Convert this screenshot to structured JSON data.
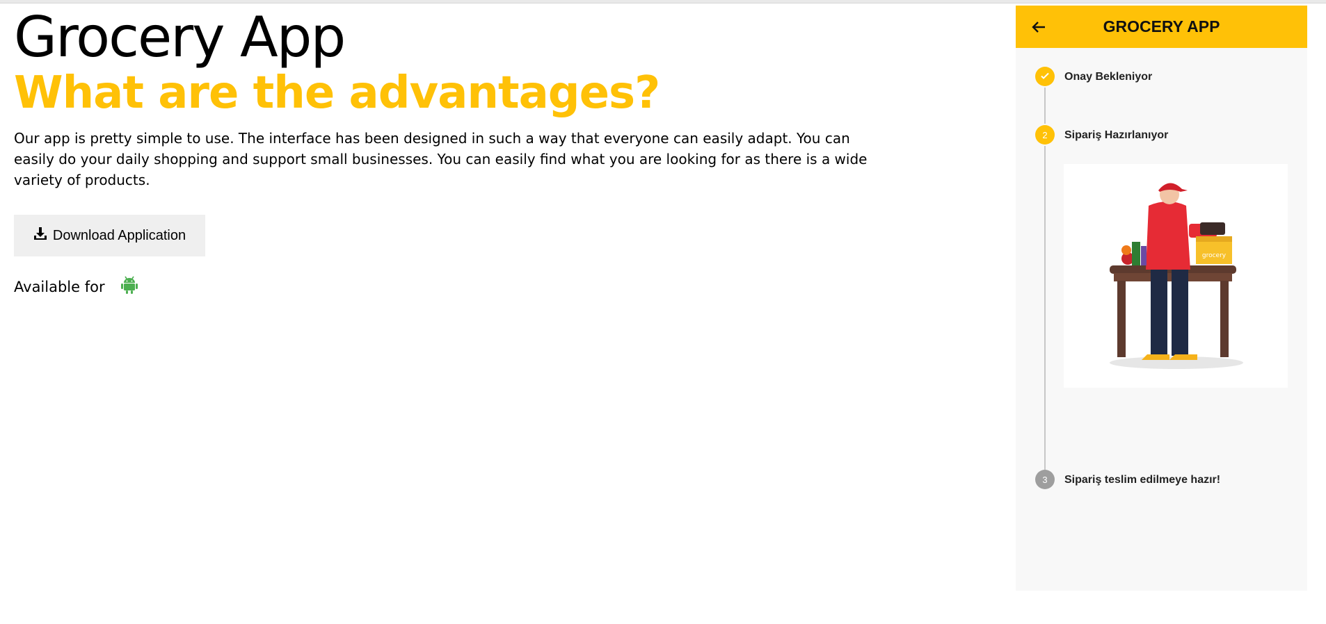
{
  "hero": {
    "title": "Grocery App",
    "subtitle": "What are the advantages?",
    "description": "Our app is pretty simple to use. The interface has been designed in such a way that everyone can easily adapt. You can easily do your daily shopping and support small businesses. You can easily find what you are looking for as there is a wide variety of products.",
    "download_label": "Download Application",
    "available_label": "Available for"
  },
  "phone": {
    "title": "GROCERY APP",
    "steps": [
      {
        "number": "1",
        "label": "Onay Bekleniyor",
        "status": "completed"
      },
      {
        "number": "2",
        "label": "Sipariş Hazırlanıyor",
        "status": "active"
      },
      {
        "number": "3",
        "label": "Sipariş teslim edilmeye hazır!",
        "status": "pending"
      }
    ]
  },
  "colors": {
    "accent": "#FFC107",
    "android_green": "#4CAF50",
    "pending_grey": "#9e9e9e"
  },
  "icons": {
    "download": "download-icon",
    "android": "android-icon",
    "back": "arrow-left-icon",
    "check": "check-icon"
  }
}
